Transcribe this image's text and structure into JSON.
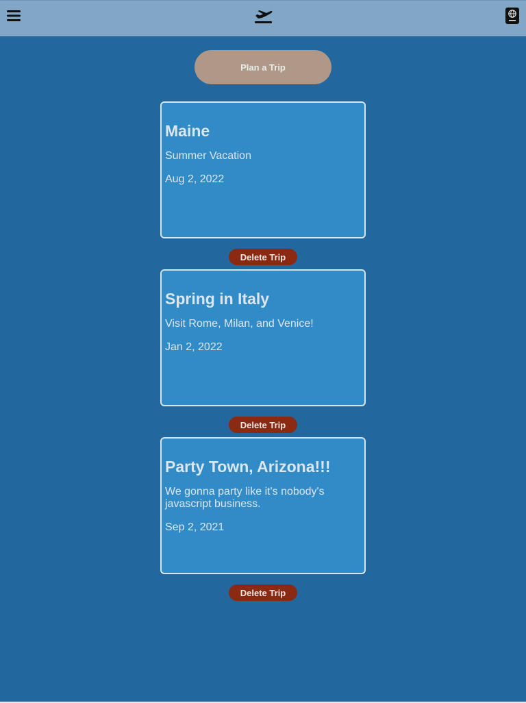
{
  "navbar": {
    "icons": {
      "menu": "hamburger-menu-icon",
      "home": "airplane-departure-icon",
      "passport": "passport-icon"
    }
  },
  "plan_button": {
    "label": "Plan a Trip"
  },
  "trips": [
    {
      "title": "Maine",
      "description": "Summer Vacation",
      "date": "Aug 2, 2022",
      "delete_label": "Delete Trip"
    },
    {
      "title": "Spring in Italy",
      "description": "Visit Rome, Milan, and Venice!",
      "date": "Jan 2, 2022",
      "delete_label": "Delete Trip"
    },
    {
      "title": "Party Town, Arizona!!!",
      "description": "We gonna party like it's nobody's javascript business.",
      "date": "Sep 2, 2021",
      "delete_label": "Delete Trip"
    }
  ],
  "colors": {
    "background": "#23679f",
    "navbar": "#82a6c6",
    "card": "#318bc6",
    "card_border": "#d8e4ee",
    "plan_button": "#b09888",
    "delete_button": "#8a2a13"
  }
}
